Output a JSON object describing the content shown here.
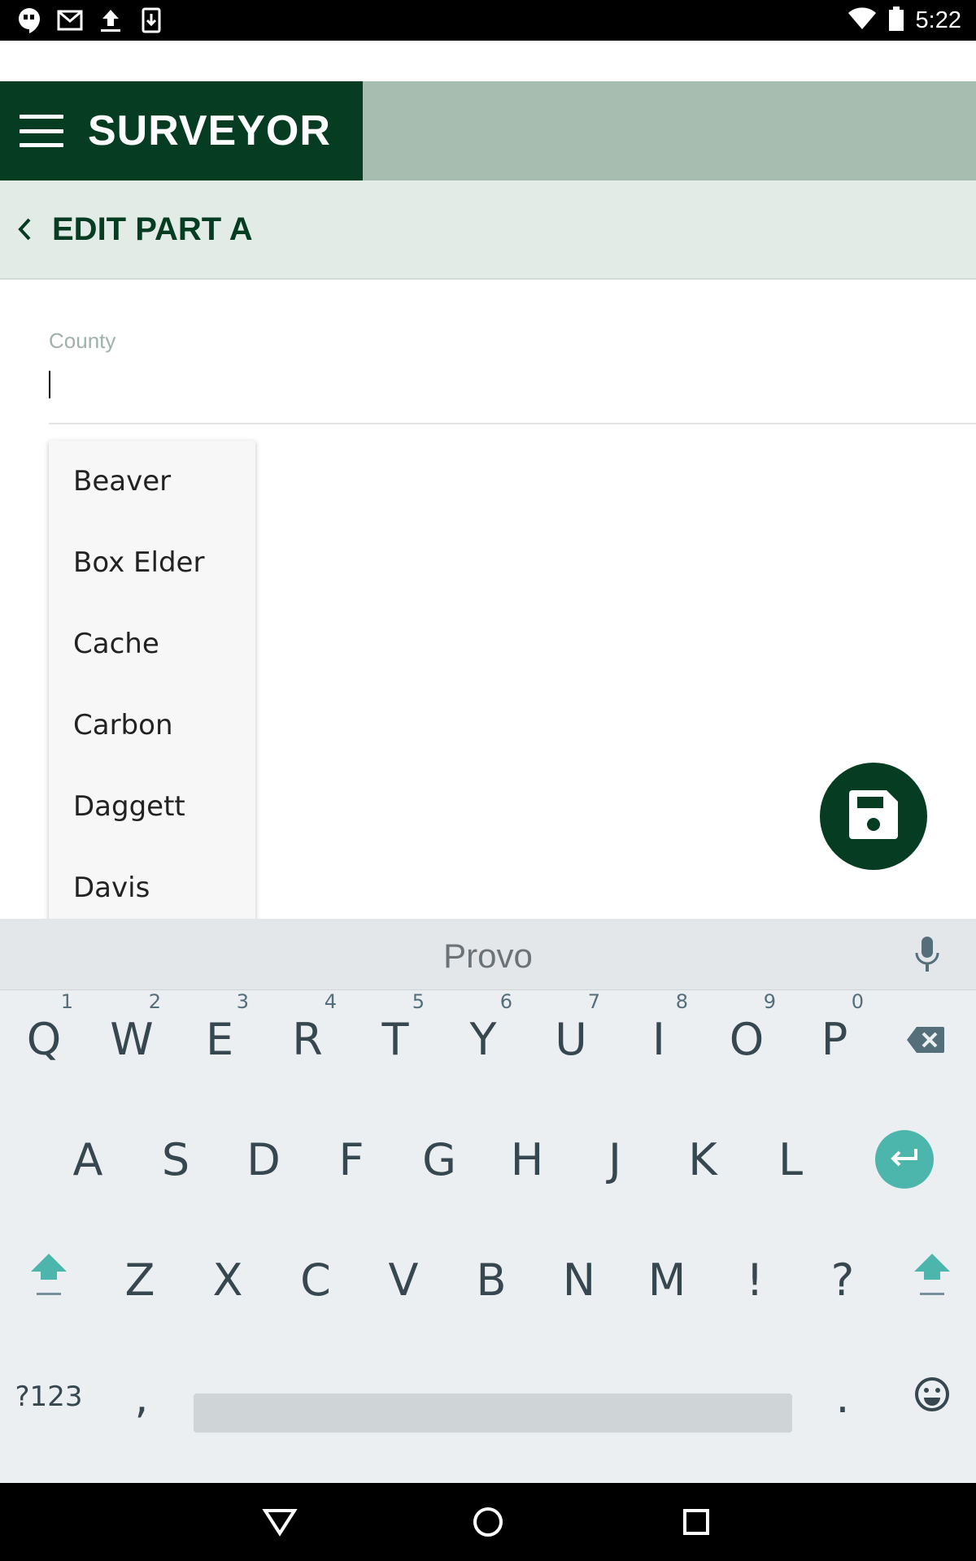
{
  "status_bar": {
    "time": "5:22",
    "left_icons": [
      "hangouts-icon",
      "gmail-icon",
      "upload-icon",
      "download-icon"
    ],
    "right_icons": [
      "wifi-icon",
      "battery-icon"
    ]
  },
  "app_bar": {
    "title": "SURVEYOR",
    "menu_icon": "menu-icon",
    "brand_color": "#063d22",
    "bar_color": "#a6bdb0"
  },
  "sub_header": {
    "title": "EDIT PART A",
    "back_icon": "chevron-left-icon"
  },
  "form": {
    "county_label": "County",
    "county_value": "",
    "dropdown_options": [
      "Beaver",
      "Box Elder",
      "Cache",
      "Carbon",
      "Daggett",
      "Davis"
    ]
  },
  "fab": {
    "icon": "save-icon"
  },
  "keyboard": {
    "suggestion": "Provo",
    "row1": [
      {
        "key": "Q",
        "hint": "1"
      },
      {
        "key": "W",
        "hint": "2"
      },
      {
        "key": "E",
        "hint": "3"
      },
      {
        "key": "R",
        "hint": "4"
      },
      {
        "key": "T",
        "hint": "5"
      },
      {
        "key": "Y",
        "hint": "6"
      },
      {
        "key": "U",
        "hint": "7"
      },
      {
        "key": "I",
        "hint": "8"
      },
      {
        "key": "O",
        "hint": "9"
      },
      {
        "key": "P",
        "hint": "0"
      }
    ],
    "row2": [
      "A",
      "S",
      "D",
      "F",
      "G",
      "H",
      "J",
      "K",
      "L"
    ],
    "row3": [
      "Z",
      "X",
      "C",
      "V",
      "B",
      "N",
      "M",
      "!",
      "?"
    ],
    "symbols_key": "?123",
    "comma_key": ",",
    "period_key": ".",
    "accent_color": "#4db6ac"
  }
}
